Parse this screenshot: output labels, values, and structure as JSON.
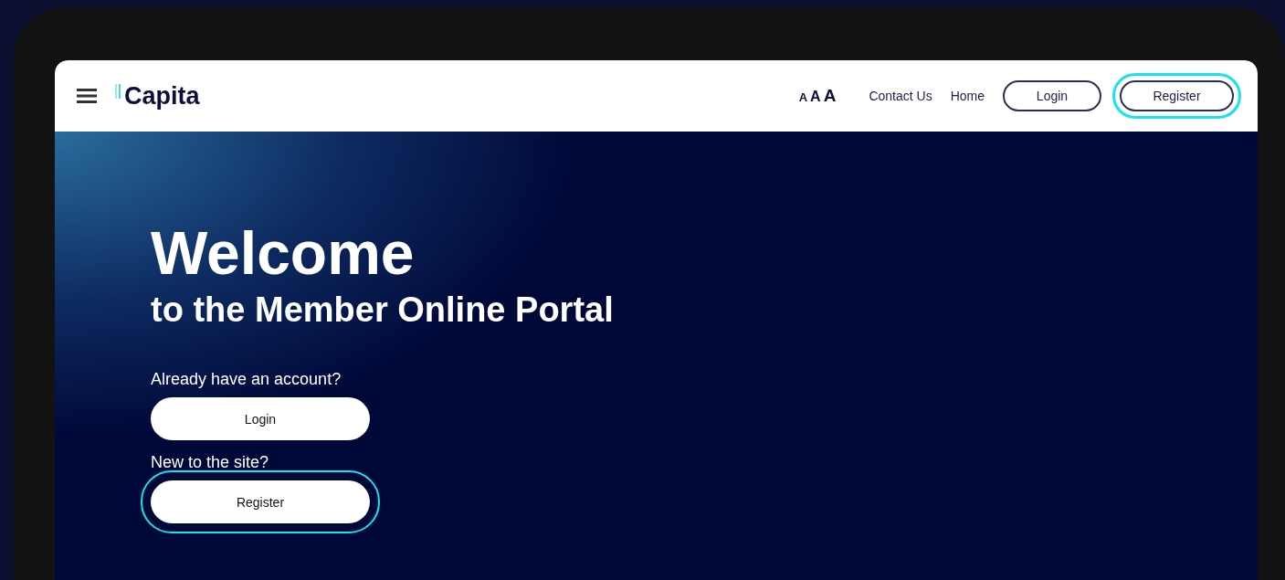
{
  "header": {
    "logo": "Capita",
    "text_size": [
      "A",
      "A",
      "A"
    ],
    "links": [
      "Contact Us",
      "Home"
    ],
    "buttons": [
      {
        "label": "Login",
        "highlighted": false
      },
      {
        "label": "Register",
        "highlighted": true
      }
    ]
  },
  "hero": {
    "title": "Welcome",
    "subtitle": "to the Member Online Portal",
    "sections": [
      {
        "prompt": "Already have an account?",
        "button": "Login",
        "highlighted": false
      },
      {
        "prompt": "New to the site?",
        "button": "Register",
        "highlighted": true
      }
    ]
  }
}
